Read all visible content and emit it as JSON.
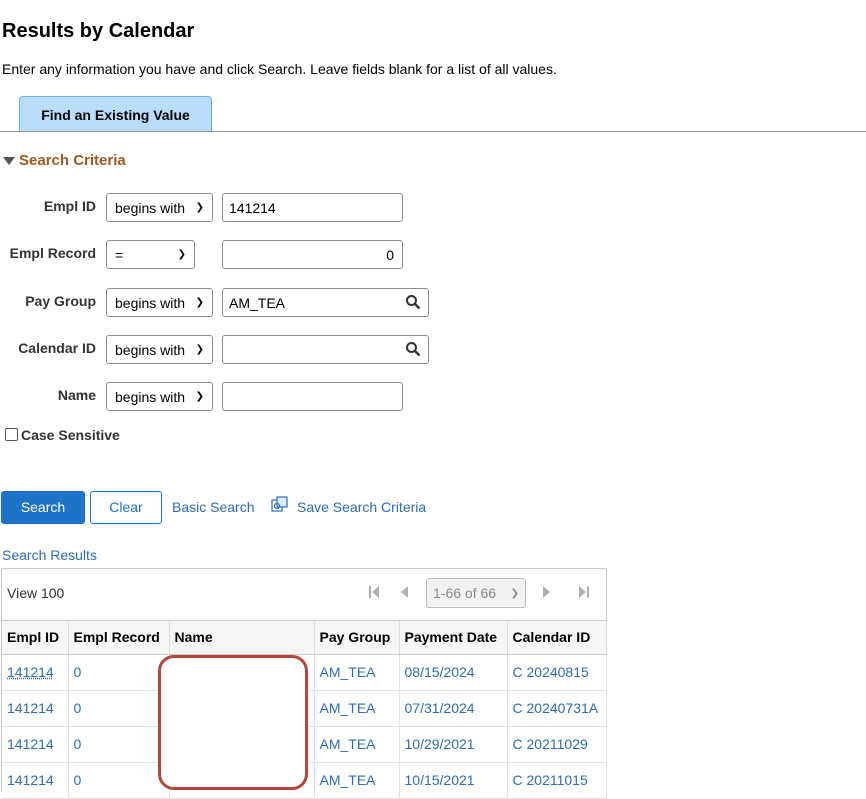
{
  "page": {
    "title": "Results by Calendar",
    "instructions": "Enter any information you have and click Search. Leave fields blank for a list of all values."
  },
  "tab": {
    "label": "Find an Existing Value"
  },
  "criteria": {
    "heading": "Search Criteria",
    "fields": [
      {
        "label": "Empl ID",
        "operator": "begins with",
        "value": "141214"
      },
      {
        "label": "Empl Record",
        "operator": "=",
        "value": "0"
      },
      {
        "label": "Pay Group",
        "operator": "begins with",
        "value": "AM_TEA"
      },
      {
        "label": "Calendar ID",
        "operator": "begins with",
        "value": ""
      },
      {
        "label": "Name",
        "operator": "begins with",
        "value": ""
      }
    ],
    "case_sensitive_label": "Case Sensitive"
  },
  "actions": {
    "search": "Search",
    "clear": "Clear",
    "basic_search": "Basic Search",
    "save_criteria": "Save Search Criteria"
  },
  "results": {
    "heading": "Search Results",
    "view_label": "View 100",
    "page_select": "1-66 of 66",
    "columns": [
      "Empl ID",
      "Empl Record",
      "Name",
      "Pay Group",
      "Payment Date",
      "Calendar ID"
    ],
    "rows": [
      [
        "141214",
        "0",
        "",
        "AM_TEA",
        "08/15/2024",
        "C 20240815"
      ],
      [
        "141214",
        "0",
        "",
        "AM_TEA",
        "07/31/2024",
        "C 20240731A"
      ],
      [
        "141214",
        "0",
        "",
        "AM_TEA",
        "10/29/2021",
        "C 20211029"
      ],
      [
        "141214",
        "0",
        "",
        "AM_TEA",
        "10/15/2021",
        "C 20211015"
      ]
    ]
  },
  "colors": {
    "accent": "#1e73c8",
    "link": "#2d6db5",
    "section_heading": "#a15a1f",
    "tab_bg": "#b9defc",
    "redaction_border": "#b5473a"
  }
}
